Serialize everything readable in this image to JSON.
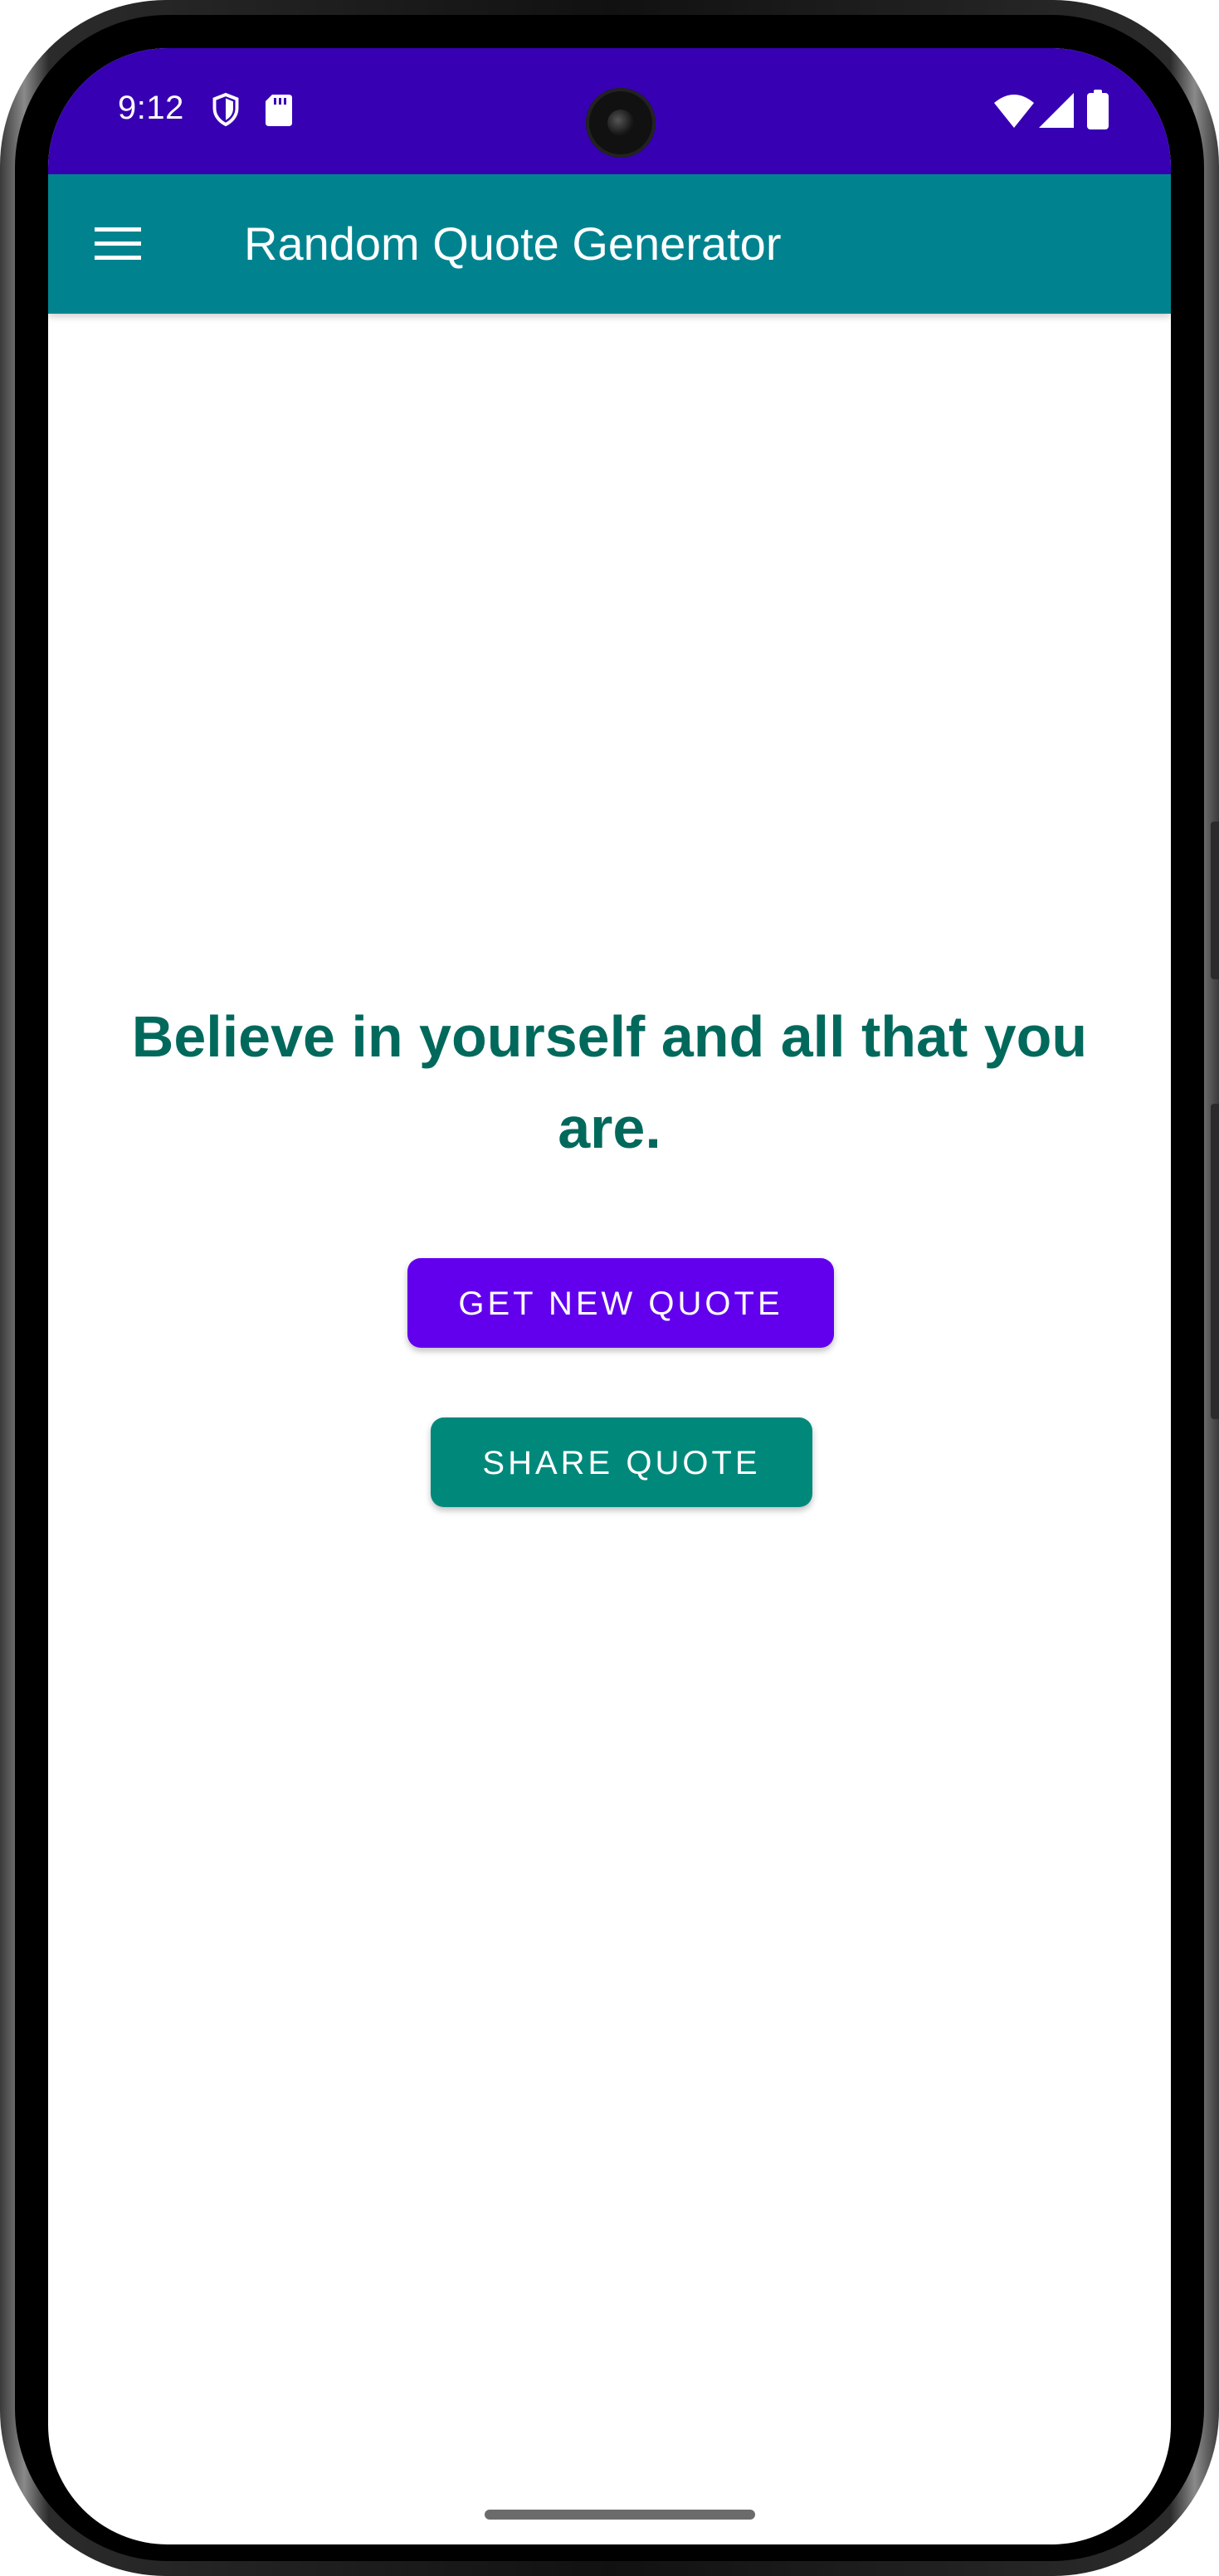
{
  "status_bar": {
    "time": "9:12",
    "icons": [
      "shield-icon",
      "sd-card-icon",
      "wifi-icon",
      "signal-icon",
      "battery-icon"
    ],
    "background": "#3700b3"
  },
  "app_bar": {
    "title": "Random Quote Generator",
    "menu_icon": "hamburger-menu-icon",
    "background": "#00838f"
  },
  "quote": {
    "text": "Believe in yourself and all that you are.",
    "color": "#00695c"
  },
  "buttons": {
    "new_quote_label": "GET NEW QUOTE",
    "new_quote_color": "#6200ee",
    "share_label": "SHARE QUOTE",
    "share_color": "#00897b"
  }
}
